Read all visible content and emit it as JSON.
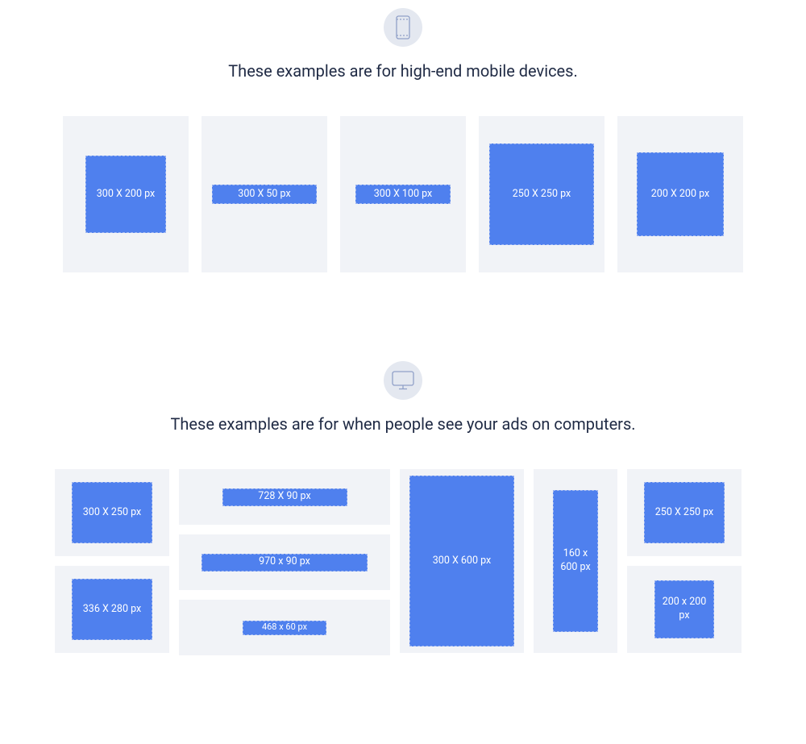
{
  "mobile": {
    "title": "These examples are for high-end mobile devices.",
    "sizes": [
      "300 X 200 px",
      "300 X 50 px",
      "300 X 100 px",
      "250 X 250 px",
      "200 X 200 px"
    ]
  },
  "desktop": {
    "title": "These examples are for when people see your ads on computers.",
    "colA": [
      "300 X 250 px",
      "336 X 280 px"
    ],
    "colB": [
      "728 X 90 px",
      "970 x 90 px",
      "468 x 60 px"
    ],
    "colC": "300 X 600 px",
    "colD": "160 x 600 px",
    "colE": [
      "250 X 250 px",
      "200 x 200 px"
    ]
  }
}
